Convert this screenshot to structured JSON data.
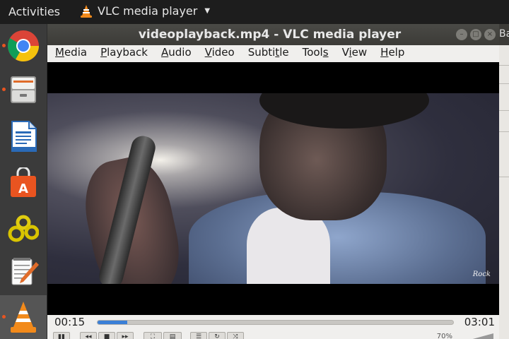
{
  "topbar": {
    "activities": "Activities",
    "app_name": "VLC media player"
  },
  "dock": {
    "items": [
      {
        "name": "Google Chrome",
        "icon": "chrome-icon",
        "running": true
      },
      {
        "name": "Files",
        "icon": "file-cabinet-icon",
        "running": true
      },
      {
        "name": "LibreOffice Writer",
        "icon": "writer-document-icon",
        "running": false
      },
      {
        "name": "Ubuntu Software",
        "icon": "shopping-bag-icon",
        "running": false
      },
      {
        "name": "Settings Tool",
        "icon": "gears-icon",
        "running": false
      },
      {
        "name": "Text Editor",
        "icon": "notepad-pencil-icon",
        "running": false
      },
      {
        "name": "VLC media player",
        "icon": "vlc-cone-icon",
        "running": true
      }
    ]
  },
  "background_window": {
    "title_fragment": "Ba"
  },
  "vlc": {
    "title": "videoplayback.mp4 - VLC media player",
    "menu": [
      {
        "pre": "",
        "u": "M",
        "post": "edia"
      },
      {
        "pre": "",
        "u": "P",
        "post": "layback"
      },
      {
        "pre": "",
        "u": "A",
        "post": "udio"
      },
      {
        "pre": "",
        "u": "V",
        "post": "ideo"
      },
      {
        "pre": "Subti",
        "u": "t",
        "post": "le"
      },
      {
        "pre": "Tool",
        "u": "s",
        "post": ""
      },
      {
        "pre": "V",
        "u": "i",
        "post": "ew"
      },
      {
        "pre": "",
        "u": "H",
        "post": "elp"
      }
    ],
    "video": {
      "watermark": "Rock"
    },
    "timeline": {
      "elapsed": "00:15",
      "total": "03:01",
      "progress": 0.083
    },
    "volume": {
      "label": "70%",
      "level": 0.7
    }
  },
  "colors": {
    "accent": "#3a7fd6",
    "dock_indicator": "#e95420",
    "titlebar": "#3c3b37",
    "vlc_orange": "#f28a1b"
  }
}
